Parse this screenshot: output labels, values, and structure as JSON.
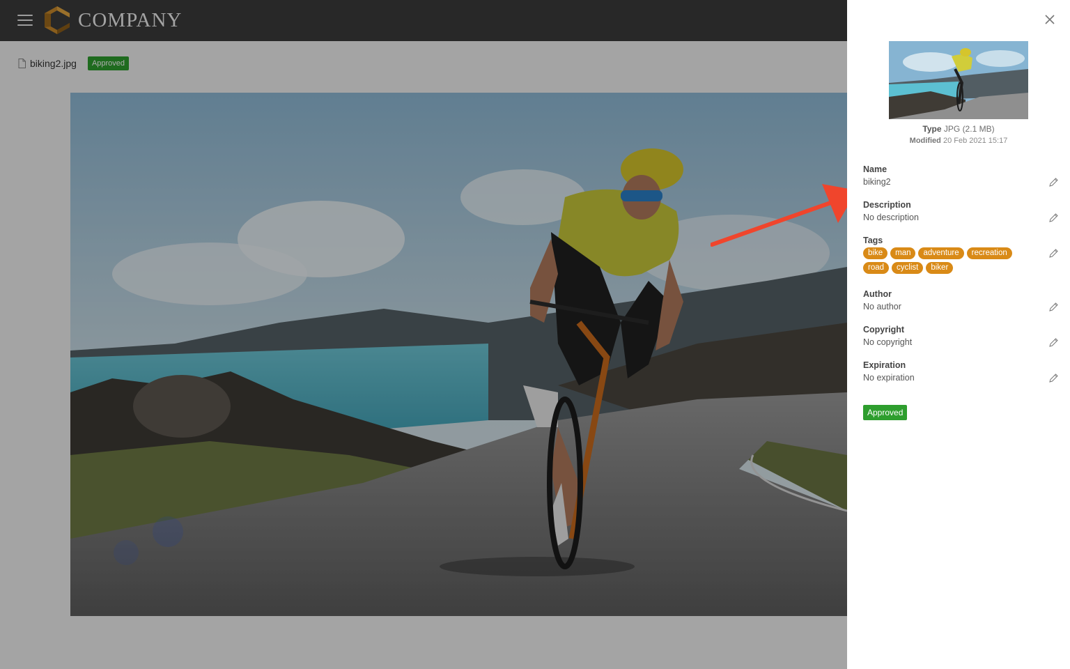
{
  "app": {
    "brand": "COMPANY"
  },
  "file": {
    "name": "biking2.jpg",
    "status": "Approved"
  },
  "details": {
    "type_label": "Type",
    "type_value": "JPG (2.1 MB)",
    "modified_label": "Modified",
    "modified_value": "20 Feb 2021 15:17",
    "name_label": "Name",
    "name_value": "biking2",
    "description_label": "Description",
    "description_value": "No description",
    "tags_label": "Tags",
    "tags": [
      "bike",
      "man",
      "adventure",
      "recreation",
      "road",
      "cyclist",
      "biker"
    ],
    "author_label": "Author",
    "author_value": "No author",
    "copyright_label": "Copyright",
    "copyright_value": "No copyright",
    "expiration_label": "Expiration",
    "expiration_value": "No expiration",
    "status": "Approved"
  },
  "icons": {
    "menu": "hamburger-menu-icon",
    "logo": "company-logo-icon",
    "file": "file-icon",
    "close": "close-icon",
    "edit": "pencil-icon"
  },
  "colors": {
    "topbar": "#3b3b3b",
    "approved": "#2e9e2e",
    "tag": "#d98a17",
    "arrow": "#f0452c"
  }
}
